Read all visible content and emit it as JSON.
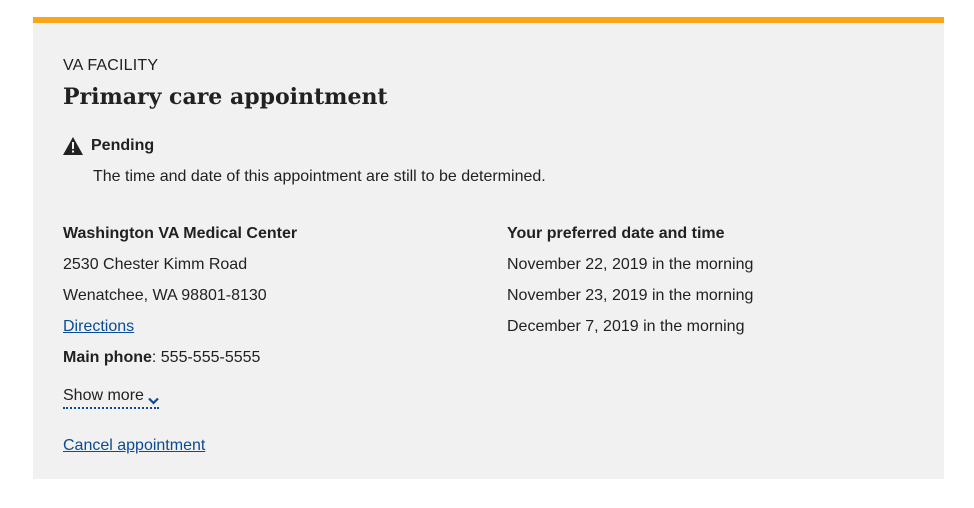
{
  "card": {
    "eyebrow": "VA FACILITY",
    "title": "Primary care appointment",
    "accent_color": "#f9a61a",
    "background": "#f1f1f1"
  },
  "status": {
    "icon": "warning-triangle-icon",
    "label": "Pending",
    "description": "The time and date of this appointment are still to be determined."
  },
  "facility": {
    "name": "Washington VA Medical Center",
    "address_line1": "2530 Chester Kimm Road",
    "address_line2": "Wenatchee, WA 98801-8130",
    "directions_label": "Directions",
    "phone_label": "Main phone",
    "phone_value": ": 555-555-5555"
  },
  "preferred": {
    "heading": "Your preferred date and time",
    "dates": [
      "November 22, 2019 in the morning",
      "November 23, 2019 in the morning",
      "December 7, 2019 in the morning"
    ]
  },
  "actions": {
    "show_more_label": "Show more",
    "cancel_label": "Cancel appointment",
    "link_color": "#0b4b94"
  }
}
